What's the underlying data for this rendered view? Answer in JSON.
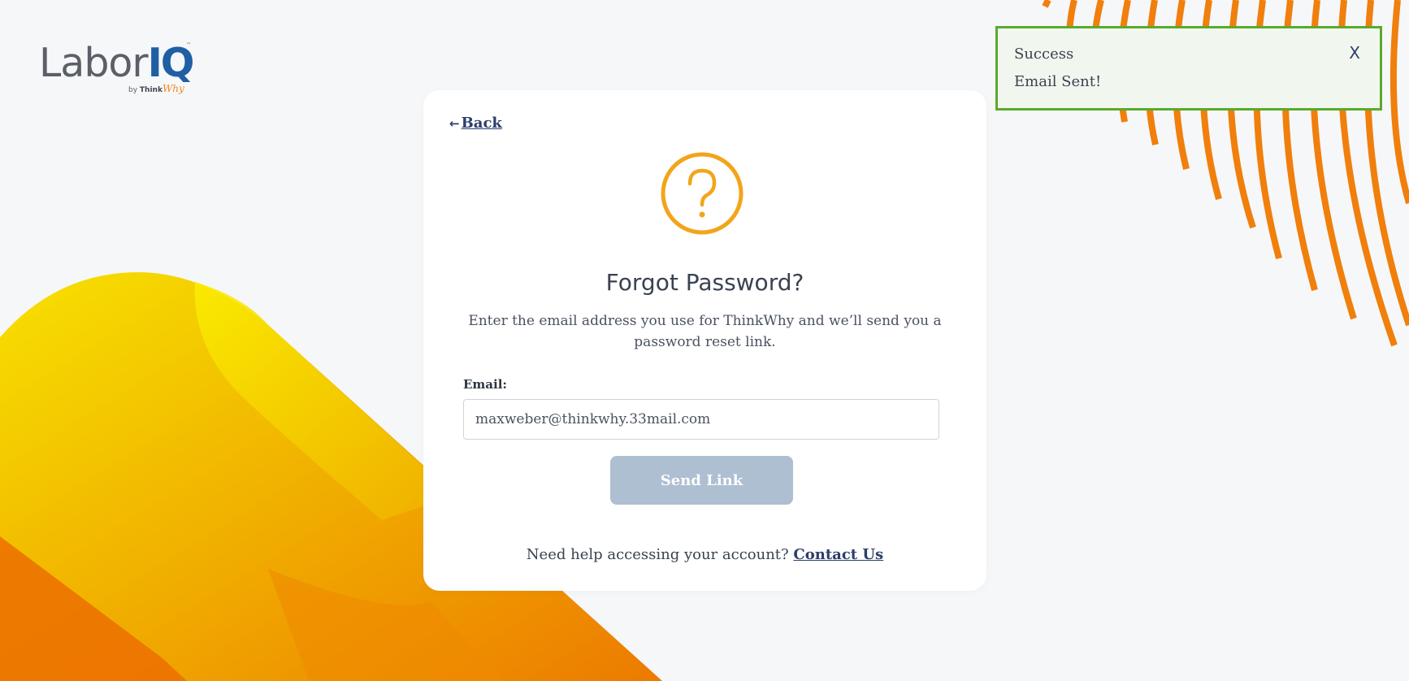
{
  "brand": {
    "name_part1": "Labor",
    "name_part2": "IQ",
    "trademark": "™",
    "by": "by",
    "think": "Think",
    "why": "Why"
  },
  "card": {
    "back_arrow": "←",
    "back_label": "Back",
    "icon": "question-circle-icon",
    "title": "Forgot Password?",
    "subtitle": "Enter the email address you use for ThinkWhy and we’ll send you a password reset link.",
    "email_label": "Email:",
    "email_value": "maxweber@thinkwhy.33mail.com",
    "send_button": "Send Link",
    "help_text": "Need help accessing your account?",
    "contact_link": "Contact Us"
  },
  "toast": {
    "title": "Success",
    "message": "Email Sent!",
    "close": "X"
  },
  "colors": {
    "accent_orange": "#f0891e",
    "icon_yellow": "#f2a51a",
    "link_navy": "#2c3e6b",
    "button_disabled": "#adbfd1",
    "success_green": "#5aaa2d",
    "brand_blue": "#1f5fa3"
  }
}
